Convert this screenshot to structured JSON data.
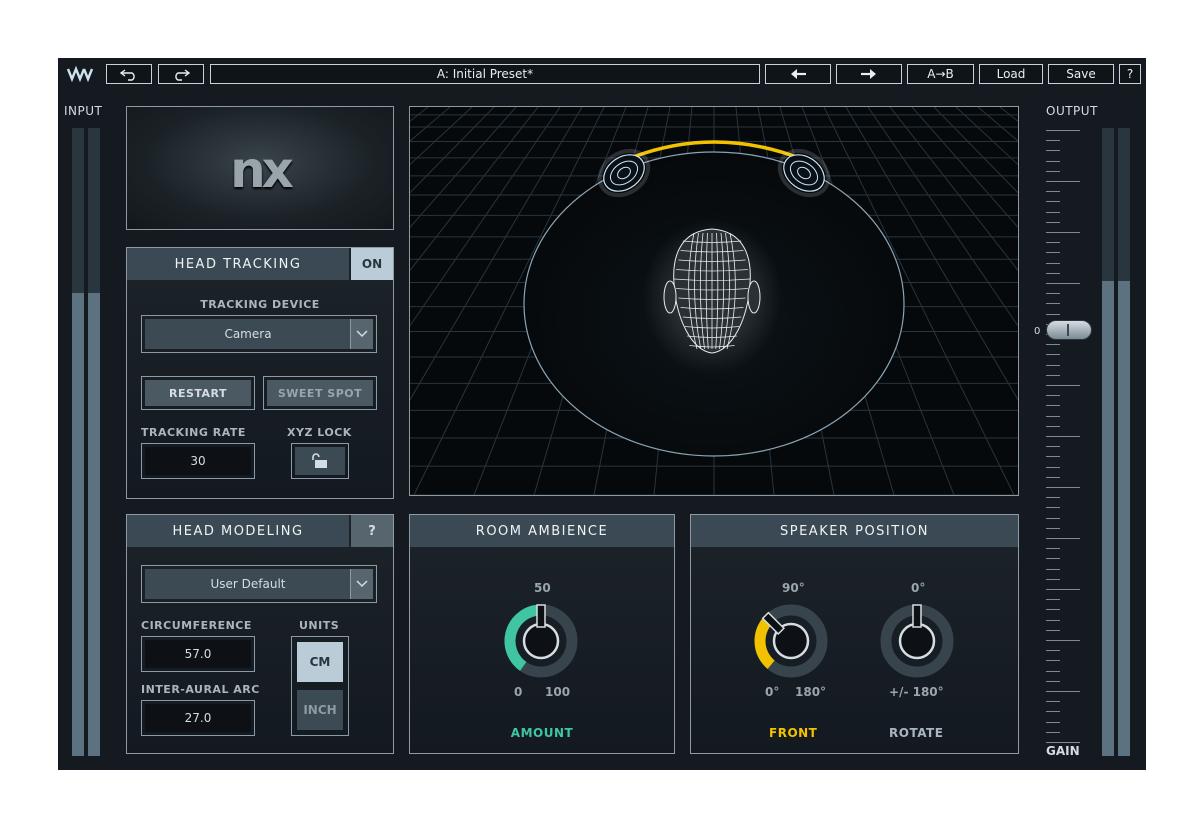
{
  "toolbar": {
    "preset_name": "A: Initial Preset*",
    "ab_label": "A→B",
    "load_label": "Load",
    "save_label": "Save",
    "help_label": "?"
  },
  "input": {
    "label": "INPUT",
    "level_left": 0.82,
    "level_right": 0.82
  },
  "output": {
    "label": "OUTPUT",
    "gain_label": "GAIN",
    "gain_zero_label": "0",
    "level_left": 0.84,
    "level_right": 0.84
  },
  "logo": {
    "text": "nx"
  },
  "head_tracking": {
    "title": "HEAD TRACKING",
    "on_label": "ON",
    "device_label": "TRACKING DEVICE",
    "device_value": "Camera",
    "restart_label": "RESTART",
    "sweet_spot_label": "SWEET SPOT",
    "rate_label": "TRACKING RATE",
    "rate_value": "30",
    "xyz_label": "XYZ LOCK"
  },
  "head_modeling": {
    "title": "HEAD MODELING",
    "help_label": "?",
    "profile_value": "User Default",
    "circ_label": "CIRCUMFERENCE",
    "circ_value": "57.0",
    "arc_label": "INTER-AURAL ARC",
    "arc_value": "27.0",
    "units_label": "UNITS",
    "cm_label": "CM",
    "inch_label": "INCH"
  },
  "room": {
    "title": "ROOM AMBIENCE",
    "value_label": "50",
    "min_label": "0",
    "max_label": "100",
    "knob_label": "AMOUNT",
    "amount": 50
  },
  "speaker": {
    "title": "SPEAKER POSITION",
    "front_top": "90°",
    "front_min": "0°",
    "front_max": "180°",
    "front_label": "FRONT",
    "rotate_top": "0°",
    "rotate_range": "+/- 180°",
    "rotate_label": "ROTATE"
  },
  "colors": {
    "accent_yellow": "#f2c200",
    "accent_teal": "#3fc6a0",
    "panel_header": "#3a4953"
  }
}
